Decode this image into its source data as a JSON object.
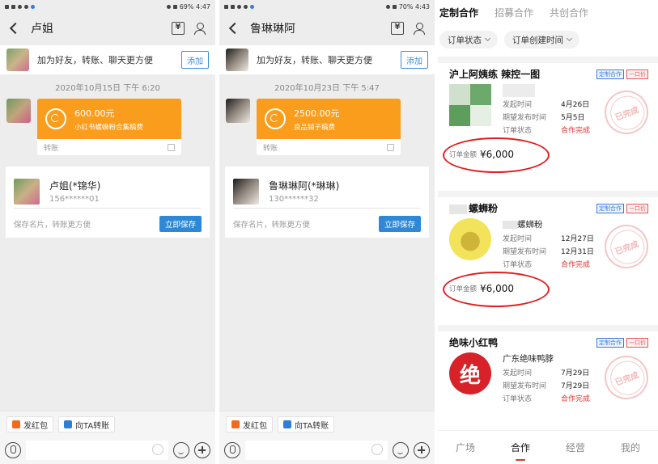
{
  "chat1": {
    "status_left": "⁴ᴳ ᵍ²ᴳ",
    "status_right": "69% 4:47",
    "title": "卢姐",
    "add_bar_text": "加为好友，转账、聊天更方便",
    "add_button": "添加",
    "timestamp": "2020年10月15日 下午 6:20",
    "transfer": {
      "amount": "600.00元",
      "note": "小红书螺蛳粉合集稿费",
      "footer": "转账"
    },
    "card": {
      "name": "卢姐(*锦华)",
      "phone": "156******01",
      "hint": "保存名片，转账更方便",
      "save": "立即保存"
    },
    "quick": {
      "red_packet": "发红包",
      "transfer_to": "向TA转账"
    }
  },
  "chat2": {
    "status_left": "⁴ᴳ ᵍ²ᴳ",
    "status_right": "70% 4:43",
    "title": "鲁琳琳阿",
    "add_bar_text": "加为好友，转账、聊天更方便",
    "add_button": "添加",
    "timestamp": "2020年10月23日 下午 5:47",
    "transfer": {
      "amount": "2500.00元",
      "note": "良品铺子稿费",
      "footer": "转账"
    },
    "card": {
      "name": "鲁琳琳阿(*琳琳)",
      "phone": "130******32",
      "hint": "保存名片，转账更方便",
      "save": "立即保存"
    },
    "quick": {
      "red_packet": "发红包",
      "transfer_to": "向TA转账"
    }
  },
  "orders": {
    "tabs": [
      "定制合作",
      "招募合作",
      "共创合作"
    ],
    "filters": [
      "订单状态",
      "订单创建时间"
    ],
    "badge_custom": "定制合作",
    "badge_price": "一口价",
    "stamp": "已完成",
    "labels": {
      "start": "发起时间",
      "expected": "期望发布时间",
      "status": "订单状态",
      "amount": "订单金额"
    },
    "items": [
      {
        "title": "沪上阿姨练 辣控一图",
        "shop": "",
        "start": "4月26日",
        "expected": "5月5日",
        "status": "合作完成",
        "amount": "¥6,000"
      },
      {
        "title": "螺蛳粉",
        "shop": "螺蛳粉",
        "start": "12月27日",
        "expected": "12月31日",
        "status": "合作完成",
        "amount": "¥6,000"
      },
      {
        "title": "绝味小红鸭",
        "shop": "广东绝味鸭脖",
        "start": "7月29日",
        "expected": "7月29日",
        "status": "合作完成",
        "amount": ""
      }
    ],
    "thumb3_char": "绝",
    "nav": [
      "广场",
      "合作",
      "经营",
      "我的"
    ]
  }
}
